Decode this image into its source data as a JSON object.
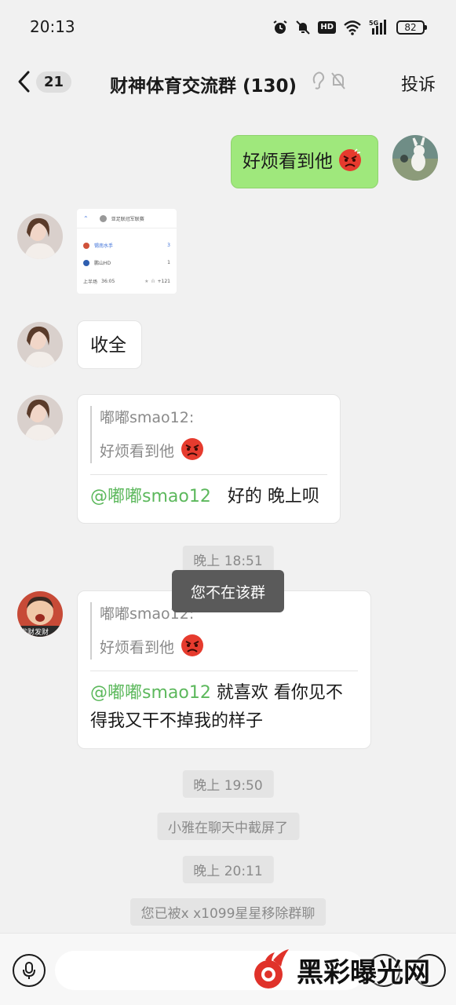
{
  "status_bar": {
    "time": "20:13",
    "hd": "HD",
    "battery": "82",
    "network": "5G"
  },
  "header": {
    "unread_count": "21",
    "title": "财神体育交流群 (130)",
    "report_label": "投诉"
  },
  "messages": {
    "m1_text": "好烦看到他",
    "screenshot": {
      "title": "亚足联冠军联赛",
      "team1": "锡南水手",
      "score1": "3",
      "team2": "鹏山HD",
      "score2": "1",
      "period": "上半场",
      "clock": "36:05",
      "count": "+121"
    },
    "m3_text": "收全",
    "m4": {
      "quote_author": "嘟嘟smao12:",
      "quote_text": "好烦看到他",
      "mention": "@嘟嘟smao12",
      "reply": "好的 晚上呗"
    },
    "time1": "晚上 18:51",
    "toast": "您不在该群",
    "m5": {
      "avatar_text": "发财发财",
      "quote_author": "嘟嘟smao12:",
      "quote_text": "好烦看到他",
      "mention": "@嘟嘟smao12",
      "reply": "就喜欢 看你见不得我又干不掉我的样子"
    },
    "time2": "晚上 19:50",
    "sys1": "小雅在聊天中截屏了",
    "time3": "晚上 20:11",
    "sys2": "您已被x x1099星星移除群聊"
  },
  "watermark": "黑彩曝光网",
  "colors": {
    "background": "#f1f1f1",
    "my_bubble": "#9fe87c",
    "mention": "#5cb85c",
    "toast": "#5a5a5a"
  }
}
